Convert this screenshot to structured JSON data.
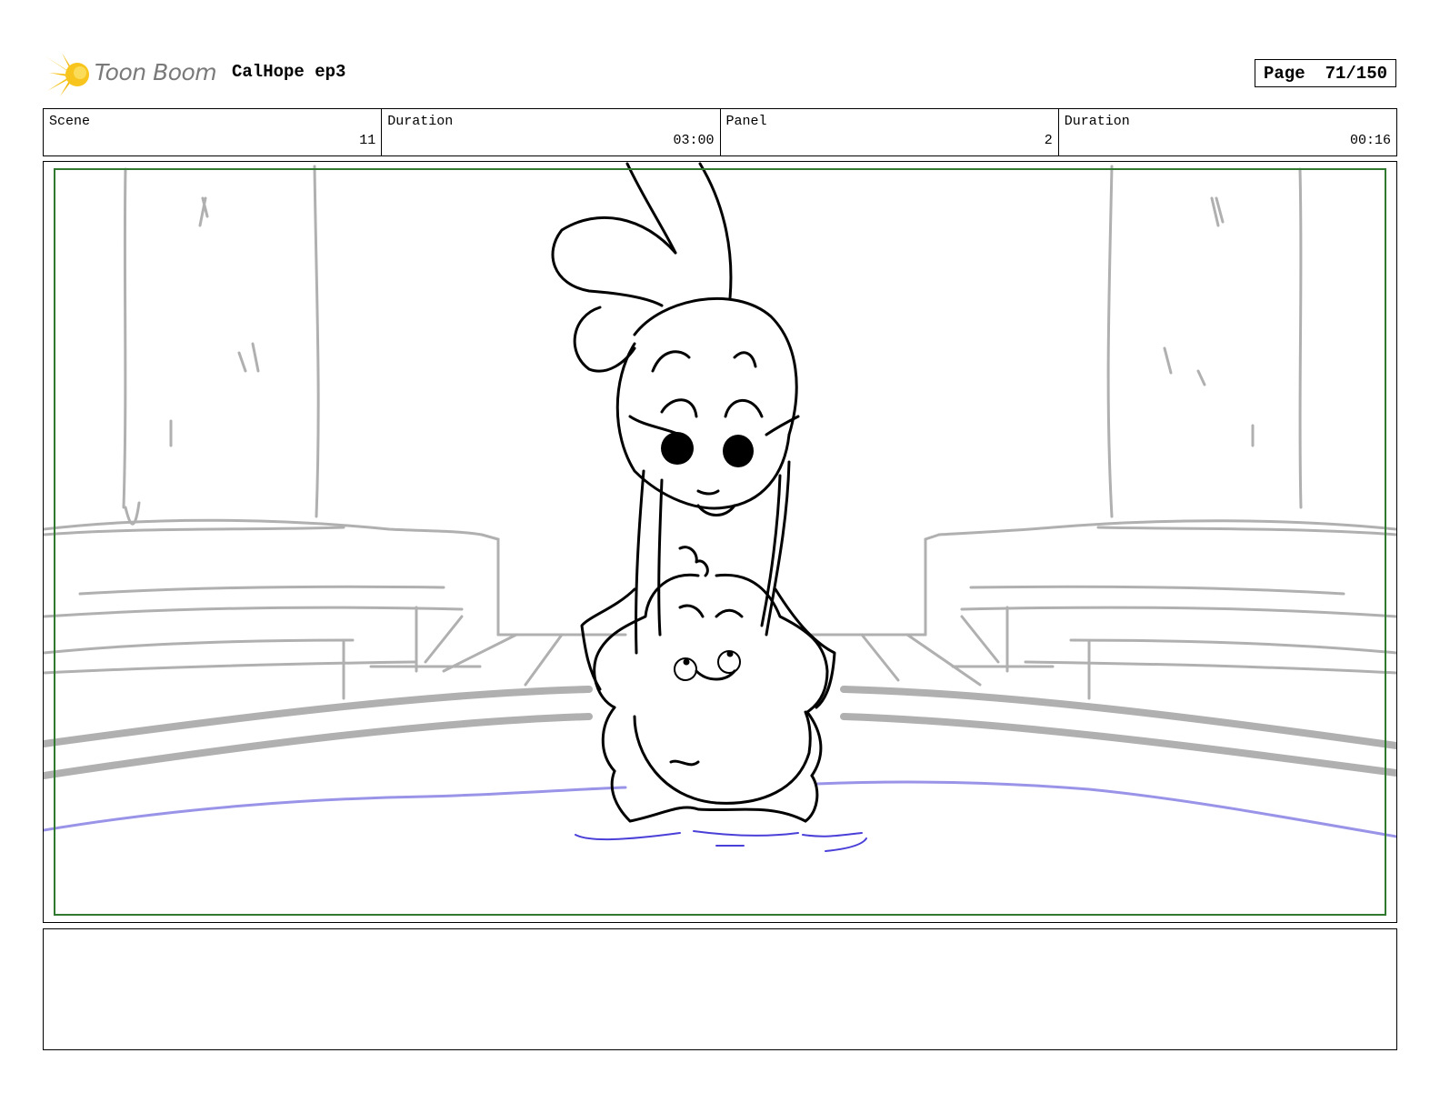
{
  "header": {
    "logo_text": "Toon Boom",
    "logo_icon": "sunburst-icon",
    "project_title": "CalHope ep3",
    "page_label": "Page",
    "page_number": "71/150"
  },
  "info": {
    "scene_label": "Scene",
    "scene_value": "11",
    "scene_duration_label": "Duration",
    "scene_duration_value": "03:00",
    "panel_label": "Panel",
    "panel_value": "2",
    "panel_duration_label": "Duration",
    "panel_duration_value": "00:16"
  },
  "colors": {
    "safe_frame": "#2f7a2f",
    "sketch_line": "#000000",
    "background_line": "#b0b0b0",
    "water_line": "#9a94e8"
  },
  "notes": ""
}
